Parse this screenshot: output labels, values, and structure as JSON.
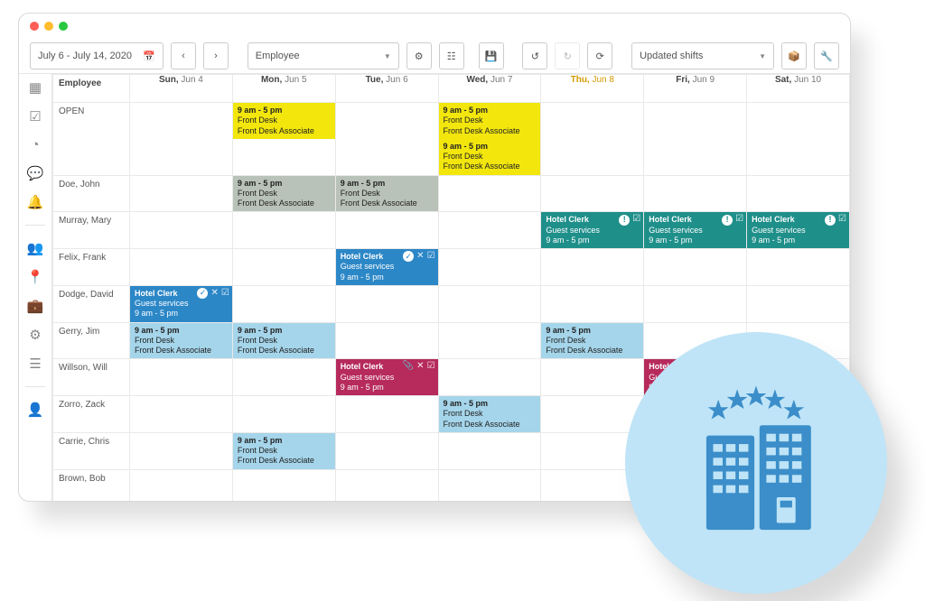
{
  "toolbar": {
    "date_range": "July 6 - July 14, 2020",
    "group_by": "Employee",
    "updated_label": "Updated shifts"
  },
  "columns": [
    {
      "label": "Employee",
      "emp": true
    },
    {
      "wd": "Sun",
      "date": "Jun 4"
    },
    {
      "wd": "Mon",
      "date": "Jun 5"
    },
    {
      "wd": "Tue",
      "date": "Jun 6"
    },
    {
      "wd": "Wed",
      "date": "Jun 7"
    },
    {
      "wd": "Thu",
      "date": "Jun 8",
      "today": true
    },
    {
      "wd": "Fri",
      "date": "Jun 9"
    },
    {
      "wd": "Sat",
      "date": "Jun 10"
    }
  ],
  "shift_types": {
    "fd_yellow": {
      "title": "9 am - 5 pm",
      "l2": "Front Desk",
      "l3": "Front Desk Associate",
      "cls": "c-yellow"
    },
    "fd_gray": {
      "title": "9 am - 5 pm",
      "l2": "Front Desk",
      "l3": "Front Desk Associate",
      "cls": "c-gray"
    },
    "fd_lt": {
      "title": "9 am - 5 pm",
      "l2": "Front Desk",
      "l3": "Front Desk Associate",
      "cls": "c-ltblue"
    },
    "fd_gray2": {
      "title": "9 am - 5 pm",
      "l2": "Front Desk",
      "l3": "Front Desk Associate",
      "cls": "c-gray2"
    },
    "clerk_teal": {
      "title": "Hotel Clerk",
      "l2": "Guest services",
      "l3": "9 am - 5 pm",
      "cls": "c-teal",
      "icons": [
        "alert",
        "check"
      ]
    },
    "clerk_blue": {
      "title": "Hotel Clerk",
      "l2": "Guest services",
      "l3": "9 am - 5 pm",
      "cls": "c-blue",
      "icons": [
        "confirm",
        "close",
        "check"
      ]
    },
    "clerk_mag": {
      "title": "Hotel Clerk",
      "l2": "Guest services",
      "l3": "9 am - 5 pm",
      "cls": "c-magenta",
      "icons": [
        "attach",
        "close",
        "check"
      ]
    },
    "clerk_mag2": {
      "title": "Hotel Clerk",
      "l2": "Guest services",
      "l3": "9 am - 5 pm",
      "cls": "c-magenta",
      "icons": [
        "check"
      ]
    }
  },
  "rows": [
    {
      "name": "OPEN",
      "cells": [
        null,
        "fd_yellow",
        null,
        [
          "fd_yellow",
          "fd_yellow"
        ],
        null,
        null,
        null
      ]
    },
    {
      "name": "Doe, John",
      "cells": [
        null,
        "fd_gray",
        "fd_gray",
        null,
        null,
        null,
        null
      ]
    },
    {
      "name": "Murray, Mary",
      "cells": [
        null,
        null,
        null,
        null,
        "clerk_teal",
        "clerk_teal",
        "clerk_teal"
      ]
    },
    {
      "name": "Felix, Frank",
      "cells": [
        null,
        null,
        "clerk_blue",
        null,
        null,
        null,
        null
      ]
    },
    {
      "name": "Dodge, David",
      "cells": [
        "clerk_blue",
        null,
        null,
        null,
        null,
        null,
        null
      ]
    },
    {
      "name": "Gerry, Jim",
      "cells": [
        "fd_lt",
        "fd_lt",
        null,
        null,
        "fd_lt",
        null,
        null
      ]
    },
    {
      "name": "Willson, Will",
      "cells": [
        null,
        null,
        "clerk_mag",
        null,
        null,
        "clerk_mag",
        null
      ]
    },
    {
      "name": "Zorro, Zack",
      "cells": [
        null,
        null,
        null,
        "fd_lt",
        null,
        null,
        null
      ]
    },
    {
      "name": "Carrie, Chris",
      "cells": [
        null,
        "fd_lt",
        null,
        null,
        null,
        null,
        null
      ]
    },
    {
      "name": "Brown, Bob",
      "cells": [
        null,
        null,
        null,
        null,
        null,
        "fd_gray2",
        "clerk_mag2"
      ]
    }
  ],
  "icon_glyphs": {
    "alert": "!",
    "confirm": "✓",
    "close": "✕",
    "check": "☑",
    "attach": "📎"
  }
}
